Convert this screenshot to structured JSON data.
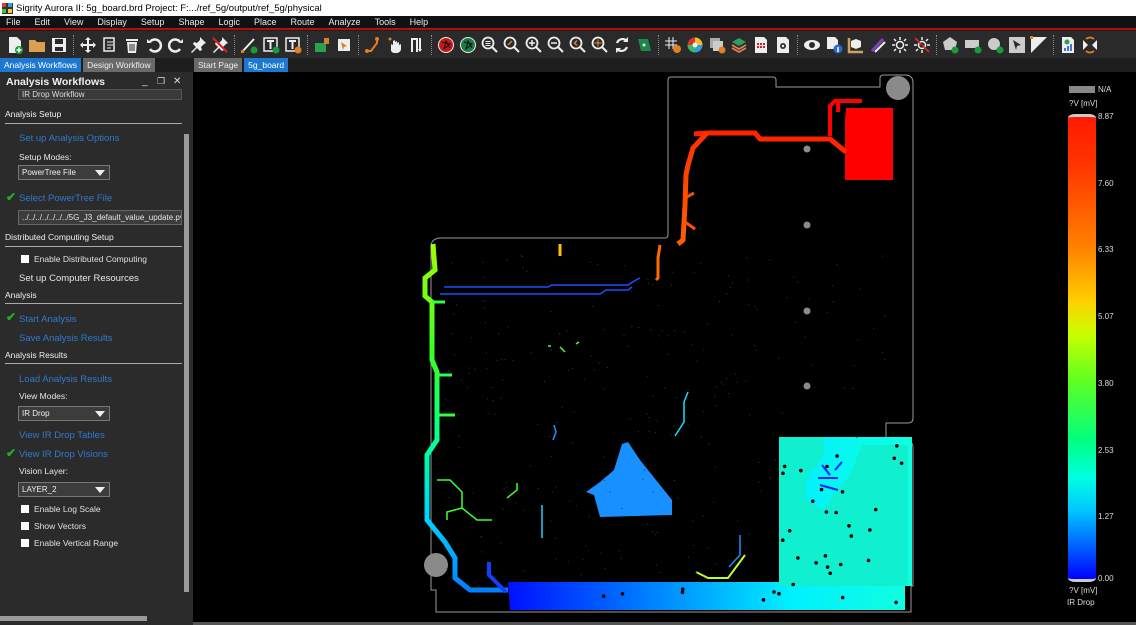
{
  "window": {
    "title": "Sigrity Aurora II: 5g_board.brd  Project: F:.../ref_5g/output/ref_5g/physical"
  },
  "menu": [
    "File",
    "Edit",
    "View",
    "Display",
    "Setup",
    "Shape",
    "Logic",
    "Place",
    "Route",
    "Analyze",
    "Tools",
    "Help"
  ],
  "toolbar": {
    "groups": [
      [
        "new-file-icon",
        "open-folder-icon",
        "save-icon"
      ],
      [
        "move-icon",
        "copy-icon",
        "delete-icon",
        "undo-icon",
        "redo-icon",
        "pin-icon",
        "unpin-icon"
      ],
      [
        "add-line-icon",
        "add-text-icon",
        "edit-text-icon"
      ],
      [
        "component-icon",
        "chip-select-icon"
      ],
      [
        "route-icon",
        "hand-route-icon",
        "swap-icon"
      ],
      [
        "ratsnest-red-icon",
        "ratsnest-green-icon",
        "zoom-list-icon",
        "zoom-fit-icon",
        "zoom-in-icon",
        "zoom-out-icon",
        "zoom-previous-icon",
        "zoom-center-icon",
        "refresh-icon",
        "board-view-icon"
      ],
      [
        "grid-icon",
        "color-wheel-icon",
        "layer-visibility-icon",
        "layers-stack-icon",
        "report-icon",
        "settings-doc-icon"
      ],
      [
        "visibility-eye-icon",
        "info-doc-icon",
        "measure-3d-icon",
        "palette-icon",
        "highlight-icon",
        "dehighlight-icon"
      ],
      [
        "add-polygon-icon",
        "add-rectangle-icon",
        "add-circle-icon",
        "select-icon",
        "diagonal-icon"
      ],
      [
        "result-report-icon",
        "exchange-icon"
      ]
    ]
  },
  "left_tabs": [
    {
      "label": "Analysis Workflows",
      "active": true
    },
    {
      "label": "Design Workflow",
      "active": false
    }
  ],
  "doc_tabs": [
    {
      "label": "Start Page",
      "active": false
    },
    {
      "label": "5g_board",
      "active": true
    }
  ],
  "panel": {
    "title": "Analysis Workflows",
    "workflow": "IR Drop Workflow",
    "sections": {
      "setup": "Analysis Setup",
      "distributed": "Distributed Computing Setup",
      "analysis": "Analysis",
      "results": "Analysis Results"
    },
    "setup_options_link": "Set up Analysis Options",
    "setup_modes_label": "Setup Modes:",
    "setup_mode_value": "PowerTree File",
    "select_powertree_link": "Select PowerTree File",
    "powertree_path": "../../../../../../../5G_J3_default_value_update.pv",
    "enable_distributed_label": "Enable Distributed Computing",
    "computer_resources_label": "Set up Computer Resources",
    "start_analysis_link": "Start Analysis",
    "save_results_link": "Save Analysis Results",
    "load_results_link": "Load Analysis Results",
    "view_modes_label": "View Modes:",
    "view_mode_value": "IR Drop",
    "view_tables_link": "View IR Drop Tables",
    "view_visions_link": "View IR Drop Visions",
    "vision_layer_label": "Vision Layer:",
    "vision_layer_value": "LAYER_2",
    "checkboxes": [
      {
        "label": "Enable Log Scale",
        "checked": false
      },
      {
        "label": "Show Vectors",
        "checked": false
      },
      {
        "label": "Enable Vertical Range",
        "checked": false
      }
    ],
    "completed_steps": [
      "Select PowerTree File",
      "Start Analysis",
      "View IR Drop Visions"
    ]
  },
  "legend": {
    "na_label": "N/A",
    "unit": "?V [mV]",
    "mode": "IR Drop",
    "ticks": [
      "8.87",
      "7.60",
      "6.33",
      "5.07",
      "3.80",
      "2.53",
      "1.27",
      "0.00"
    ],
    "max": 8.87,
    "min": 0.0
  }
}
